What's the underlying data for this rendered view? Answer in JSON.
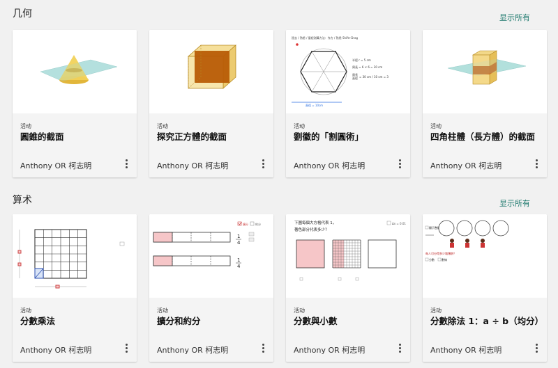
{
  "sections": [
    {
      "title": "几何",
      "show_all": "显示所有",
      "cards": [
        {
          "type": "活动",
          "title": "圓錐的截面",
          "author": "Anthony OR 柯志明",
          "thumb_icon": "cone-section-thumbnail"
        },
        {
          "type": "活动",
          "title": "探究正方體的截面",
          "author": "Anthony OR 柯志明",
          "thumb_icon": "cube-section-thumbnail"
        },
        {
          "type": "活动",
          "title": "劉徽的「割圓術」",
          "author": "Anthony OR 柯志明",
          "thumb_icon": "hexagon-circle-thumbnail"
        },
        {
          "type": "活动",
          "title": "四角柱體（長方體）的截面",
          "author": "Anthony OR 柯志明",
          "thumb_icon": "prism-section-thumbnail"
        }
      ]
    },
    {
      "title": "算术",
      "show_all": "显示所有",
      "cards": [
        {
          "type": "活动",
          "title": "分數乘法",
          "author": "Anthony OR 柯志明",
          "thumb_icon": "grid-multiplication-thumbnail"
        },
        {
          "type": "活动",
          "title": "擴分和約分",
          "author": "Anthony OR 柯志明",
          "thumb_icon": "fraction-bars-thumbnail"
        },
        {
          "type": "活动",
          "title": "分數與小數",
          "author": "Anthony OR 柯志明",
          "thumb_icon": "decimal-squares-thumbnail"
        },
        {
          "type": "活动",
          "title": "分數除法 1：a ÷ b（均分）",
          "author": "Anthony OR 柯志明",
          "thumb_icon": "division-circles-thumbnail"
        }
      ]
    }
  ],
  "thumb_text": {
    "hex_header": "過去 / 熟悉 / 量程測算方法：作方 / 熟悉       Shift+Drag",
    "hex_r": "半徑 r = 5 cm",
    "hex_perimeter": "周長 = 6 × 6 = 30 cm",
    "hex_ratio_label": "周長",
    "hex_ratio_label2": "直徑",
    "hex_ratio_value": "= 30 cm / 10 cm = 3",
    "hex_diameter": "直徑 = 10cm",
    "fb_check1": "擴分",
    "fb_check2": "約分",
    "fb_frac_num": "1",
    "fb_frac_den": "4",
    "dec_question_l1": "下圖每個大方格代表 1，",
    "dec_question_l2": "著色部分代表多少？",
    "dec_toggle": "Δx = 0.01",
    "div_label1": "顯示整體",
    "div_question": "每人可分得多少塊薄餅？",
    "div_opt1": "分數",
    "div_opt2": "數線"
  },
  "colors": {
    "accent_link": "#1f7a6e",
    "cone_yellow": "#e8c23a",
    "plane_teal": "#9fd6d4",
    "cube_orange": "#b35a00",
    "fraction_pink": "#f6c6c8"
  }
}
